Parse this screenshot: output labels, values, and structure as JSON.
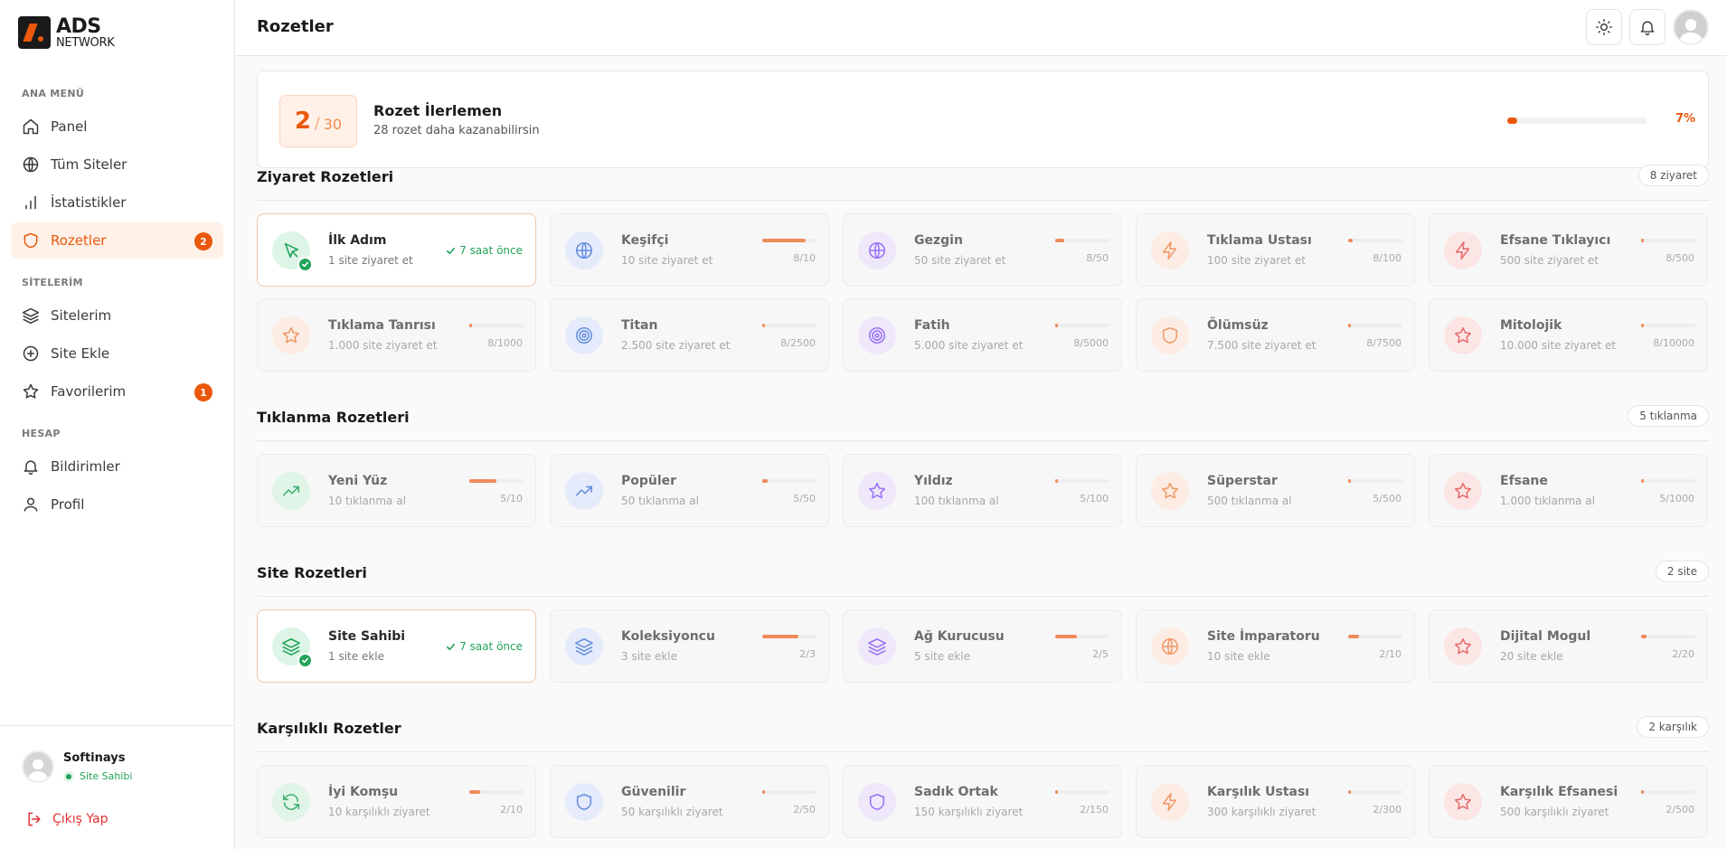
{
  "brand": {
    "line1": "ADS",
    "line2": "NETWORK"
  },
  "sidebar": {
    "sections": {
      "main": "ANA MENÜ",
      "sites": "SİTELERİM",
      "account": "HESAP"
    },
    "items": [
      {
        "label": "Panel",
        "icon": "home-icon"
      },
      {
        "label": "Tüm Siteler",
        "icon": "globe-icon"
      },
      {
        "label": "İstatistikler",
        "icon": "bar-chart-icon"
      },
      {
        "label": "Rozetler",
        "icon": "shield-icon",
        "badge": "2",
        "active": true
      },
      {
        "label": "Sitelerim",
        "icon": "layers-icon"
      },
      {
        "label": "Site Ekle",
        "icon": "plus-circle-icon"
      },
      {
        "label": "Favorilerim",
        "icon": "star-icon",
        "badge": "1"
      },
      {
        "label": "Bildirimler",
        "icon": "bell-icon"
      },
      {
        "label": "Profil",
        "icon": "user-icon"
      }
    ],
    "user": {
      "name": "Softinays",
      "role": "Site Sahibi"
    },
    "logout": "Çıkış Yap"
  },
  "header": {
    "title": "Rozetler"
  },
  "progress": {
    "earned": "2",
    "separator": "/",
    "total": "30",
    "title": "Rozet İlerlemen",
    "subtitle": "28 rozet daha kazanabilirsin",
    "percent_label": "7%",
    "percent": 7
  },
  "colors": {
    "accent": "#ea580c",
    "success": "#22a35a"
  },
  "sections": [
    {
      "title": "Ziyaret Rozetleri",
      "pill": "8 ziyaret",
      "badges": [
        {
          "name": "İlk Adım",
          "desc": "1 site ziyaret et",
          "earned": true,
          "time": "7 saat önce",
          "icon": "cursor-icon",
          "tone": "green"
        },
        {
          "name": "Keşifçi",
          "desc": "10 site ziyaret et",
          "count": "8/10",
          "progress": 0.8,
          "icon": "globe-icon",
          "tone": "blue"
        },
        {
          "name": "Gezgin",
          "desc": "50 site ziyaret et",
          "count": "8/50",
          "progress": 0.16,
          "icon": "globe-icon",
          "tone": "purple"
        },
        {
          "name": "Tıklama Ustası",
          "desc": "100 site ziyaret et",
          "count": "8/100",
          "progress": 0.08,
          "icon": "lightning-icon",
          "tone": "orange"
        },
        {
          "name": "Efsane Tıklayıcı",
          "desc": "500 site ziyaret et",
          "count": "8/500",
          "progress": 0.016,
          "icon": "lightning-icon",
          "tone": "red"
        },
        {
          "name": "Tıklama Tanrısı",
          "desc": "1.000 site ziyaret et",
          "count": "8/1000",
          "progress": 0.008,
          "icon": "star-icon",
          "tone": "orange"
        },
        {
          "name": "Titan",
          "desc": "2.500 site ziyaret et",
          "count": "8/2500",
          "progress": 0.0032,
          "icon": "target-icon",
          "tone": "blue"
        },
        {
          "name": "Fatih",
          "desc": "5.000 site ziyaret et",
          "count": "8/5000",
          "progress": 0.0016,
          "icon": "target-icon",
          "tone": "purple"
        },
        {
          "name": "Ölümsüz",
          "desc": "7.500 site ziyaret et",
          "count": "8/7500",
          "progress": 0.001,
          "icon": "shield-icon",
          "tone": "orange"
        },
        {
          "name": "Mitolojik",
          "desc": "10.000 site ziyaret et",
          "count": "8/10000",
          "progress": 0.0008,
          "icon": "star-icon",
          "tone": "red"
        }
      ]
    },
    {
      "title": "Tıklanma Rozetleri",
      "pill": "5 tıklanma",
      "badges": [
        {
          "name": "Yeni Yüz",
          "desc": "10 tıklanma al",
          "count": "5/10",
          "progress": 0.5,
          "icon": "trending-up-icon",
          "tone": "green"
        },
        {
          "name": "Popüler",
          "desc": "50 tıklanma al",
          "count": "5/50",
          "progress": 0.1,
          "icon": "trending-up-icon",
          "tone": "blue"
        },
        {
          "name": "Yıldız",
          "desc": "100 tıklanma al",
          "count": "5/100",
          "progress": 0.05,
          "icon": "star-icon",
          "tone": "purple"
        },
        {
          "name": "Süperstar",
          "desc": "500 tıklanma al",
          "count": "5/500",
          "progress": 0.01,
          "icon": "star-icon",
          "tone": "orange"
        },
        {
          "name": "Efsane",
          "desc": "1.000 tıklanma al",
          "count": "5/1000",
          "progress": 0.005,
          "icon": "star-icon",
          "tone": "red"
        }
      ]
    },
    {
      "title": "Site Rozetleri",
      "pill": "2 site",
      "badges": [
        {
          "name": "Site Sahibi",
          "desc": "1 site ekle",
          "earned": true,
          "time": "7 saat önce",
          "icon": "layers-icon",
          "tone": "green"
        },
        {
          "name": "Koleksiyoncu",
          "desc": "3 site ekle",
          "count": "2/3",
          "progress": 0.667,
          "icon": "layers-icon",
          "tone": "blue"
        },
        {
          "name": "Ağ Kurucusu",
          "desc": "5 site ekle",
          "count": "2/5",
          "progress": 0.4,
          "icon": "layers-icon",
          "tone": "purple"
        },
        {
          "name": "Site İmparatoru",
          "desc": "10 site ekle",
          "count": "2/10",
          "progress": 0.2,
          "icon": "globe-icon",
          "tone": "orange"
        },
        {
          "name": "Dijital Mogul",
          "desc": "20 site ekle",
          "count": "2/20",
          "progress": 0.1,
          "icon": "star-icon",
          "tone": "red"
        }
      ]
    },
    {
      "title": "Karşılıklı Rozetler",
      "pill": "2 karşılık",
      "badges": [
        {
          "name": "İyi Komşu",
          "desc": "10 karşılıklı ziyaret",
          "count": "2/10",
          "progress": 0.2,
          "icon": "refresh-icon",
          "tone": "green"
        },
        {
          "name": "Güvenilir",
          "desc": "50 karşılıklı ziyaret",
          "count": "2/50",
          "progress": 0.04,
          "icon": "shield-icon",
          "tone": "blue"
        },
        {
          "name": "Sadık Ortak",
          "desc": "150 karşılıklı ziyaret",
          "count": "2/150",
          "progress": 0.013,
          "icon": "shield-icon",
          "tone": "purple"
        },
        {
          "name": "Karşılık Ustası",
          "desc": "300 karşılıklı ziyaret",
          "count": "2/300",
          "progress": 0.007,
          "icon": "lightning-icon",
          "tone": "orange"
        },
        {
          "name": "Karşılık Efsanesi",
          "desc": "500 karşılıklı ziyaret",
          "count": "2/500",
          "progress": 0.004,
          "icon": "star-icon",
          "tone": "red"
        }
      ]
    }
  ]
}
